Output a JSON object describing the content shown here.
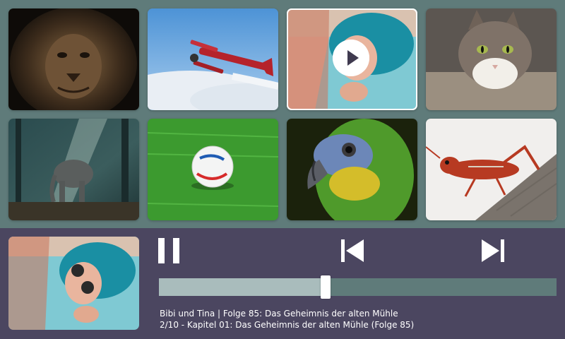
{
  "grid": {
    "tiles": [
      {
        "name": "lion",
        "subject": "lion"
      },
      {
        "name": "biplane",
        "subject": "biplane"
      },
      {
        "name": "woman-sunglasses",
        "subject": "woman-sunglasses",
        "selected": true
      },
      {
        "name": "cat",
        "subject": "cat"
      },
      {
        "name": "elephant",
        "subject": "elephant"
      },
      {
        "name": "soccer-ball",
        "subject": "soccer-ball"
      },
      {
        "name": "parrot",
        "subject": "parrot"
      },
      {
        "name": "grasshopper",
        "subject": "grasshopper"
      }
    ]
  },
  "player": {
    "track_title": "Bibi und Tina | Folge 85: Das Geheimnis der alten Mühle",
    "track_subtitle": "2/10 - Kapitel 01: Das Geheimnis der alten Mühle (Folge 85)",
    "progress": 0.42,
    "controls": {
      "pause_icon": "pause-icon",
      "prev_icon": "skip-previous-icon",
      "next_icon": "skip-next-icon"
    }
  },
  "colors": {
    "background": "#5f7b7a",
    "player_bar": "#4b4660",
    "progress_fill": "#a9bcbc",
    "progress_track": "#5f7b7a",
    "thumb": "#ffffff"
  }
}
